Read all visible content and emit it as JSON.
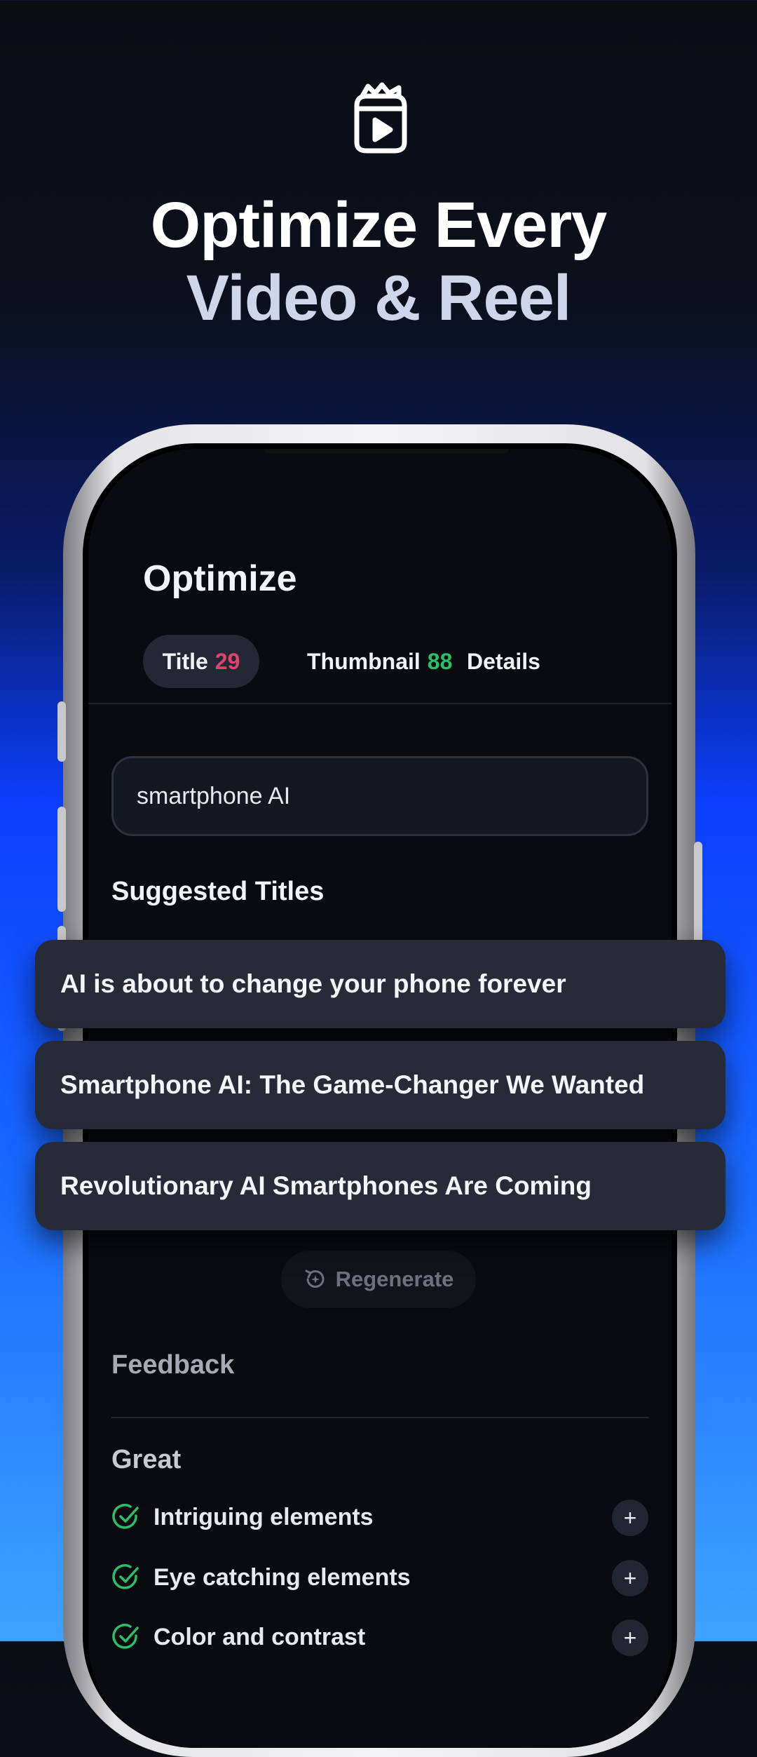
{
  "hero": {
    "icon": "tv-play-icon",
    "line1": "Optimize Every",
    "line2": "Video & Reel"
  },
  "screen": {
    "title": "Optimize",
    "tabs": [
      {
        "label": "Title",
        "score": "29",
        "score_color": "#e0446a",
        "active": true
      },
      {
        "label": "Thumbnail",
        "score": "88",
        "score_color": "#2bbf6a",
        "active": false
      },
      {
        "label": "Details",
        "score": "",
        "active": false
      }
    ],
    "search": {
      "value": "smartphone AI"
    },
    "suggested_heading": "Suggested Titles",
    "suggestions": [
      "AI is about to change your phone forever",
      "Smartphone AI: The Game-Changer We Wanted",
      "Revolutionary AI Smartphones Are Coming"
    ],
    "regenerate_label": "Regenerate",
    "feedback": {
      "heading": "Feedback",
      "group_label": "Great",
      "items": [
        {
          "label": "Intriguing elements",
          "icon": "check-circle-icon",
          "action_icon": "plus-icon"
        },
        {
          "label": "Eye catching elements",
          "icon": "check-circle-icon",
          "action_icon": "plus-icon"
        },
        {
          "label": "Color and contrast",
          "icon": "check-circle-icon",
          "action_icon": "plus-icon"
        }
      ]
    }
  },
  "colors": {
    "accent_red": "#e0446a",
    "accent_green": "#2bbf6a",
    "background_blue": "#0b3fff"
  }
}
